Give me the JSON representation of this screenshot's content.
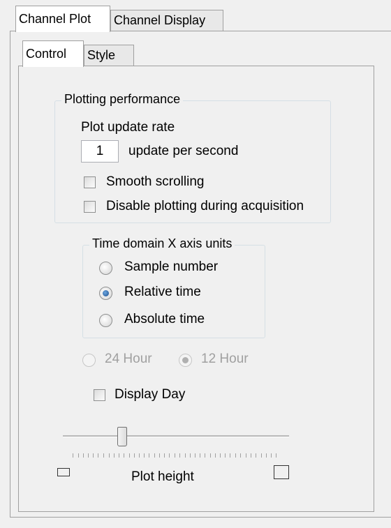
{
  "tabs_outer": [
    {
      "label": "Channel Plot",
      "active": true
    },
    {
      "label": "Channel Display",
      "active": false
    }
  ],
  "tabs_inner": [
    {
      "label": "Control",
      "active": true
    },
    {
      "label": "Style",
      "active": false
    }
  ],
  "plotting_performance": {
    "title": "Plotting performance",
    "update_rate_label": "Plot update rate",
    "update_rate_value": "1",
    "update_rate_units": "update per second",
    "smooth_scrolling": {
      "label": "Smooth scrolling",
      "checked": false
    },
    "disable_plotting": {
      "label": "Disable plotting during acquisition",
      "checked": false
    }
  },
  "x_axis_units": {
    "title": "Time domain X axis units",
    "options": [
      {
        "label": "Sample number",
        "selected": false
      },
      {
        "label": "Relative time",
        "selected": true
      },
      {
        "label": "Absolute time",
        "selected": false
      }
    ]
  },
  "clock_format": {
    "options": [
      {
        "label": "24 Hour",
        "selected": false,
        "enabled": false
      },
      {
        "label": "12 Hour",
        "selected": true,
        "enabled": false
      }
    ]
  },
  "display_day": {
    "label": "Display Day",
    "checked": false
  },
  "plot_height": {
    "label": "Plot height",
    "value_fraction": 0.25
  }
}
